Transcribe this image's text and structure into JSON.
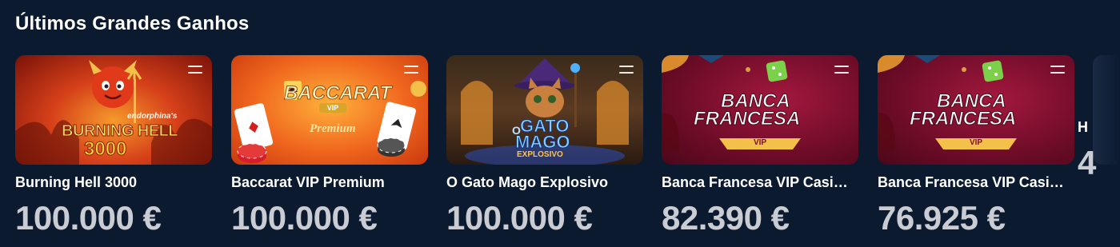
{
  "section": {
    "title": "Últimos Grandes Ganhos"
  },
  "games": [
    {
      "name": "Burning Hell 3000",
      "amount": "100.000 €",
      "art_text": "BURNING HELL",
      "art_sub": "3000",
      "art_brand": "endorphina's"
    },
    {
      "name": "Baccarat VIP Premium",
      "amount": "100.000 €",
      "art_text": "BACCARAT",
      "art_badge": "VIP",
      "art_sub": "Premium"
    },
    {
      "name": "O Gato Mago Explosivo",
      "amount": "100.000 €",
      "art_text": "GATO",
      "art_text2": "MAGO",
      "art_o": "O",
      "art_sub": "EXPLOSIVO"
    },
    {
      "name": "Banca Francesa VIP Casi…",
      "amount": "82.390 €",
      "art_text": "BANCA",
      "art_text2": "FRANCESA",
      "art_badge": "VIP"
    },
    {
      "name": "Banca Francesa VIP Casi…",
      "amount": "76.925 €",
      "art_text": "BANCA",
      "art_text2": "FRANCESA",
      "art_badge": "VIP"
    }
  ],
  "partial": {
    "name": "H",
    "amount": "4"
  },
  "icons": {
    "menu": "menu-icon"
  },
  "colors": {
    "background": "#0b1a2f",
    "amount": "#c9ccd2"
  }
}
